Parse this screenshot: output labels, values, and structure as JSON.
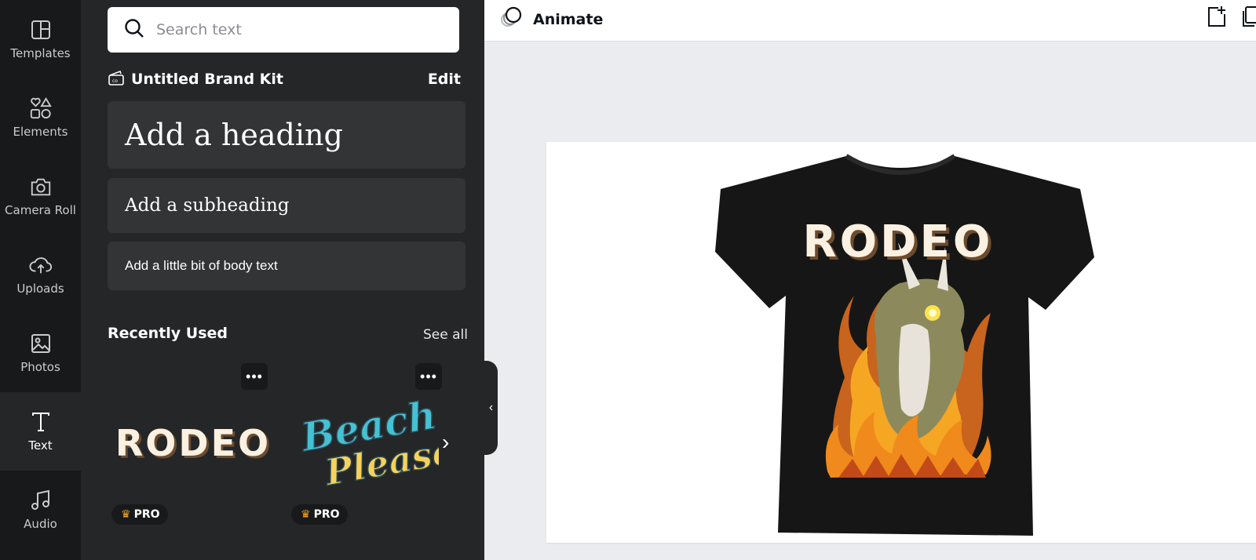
{
  "rail": {
    "items": [
      {
        "label": "Templates",
        "icon": "templates-icon"
      },
      {
        "label": "Elements",
        "icon": "elements-icon"
      },
      {
        "label": "Camera Roll",
        "icon": "camera-icon"
      },
      {
        "label": "Uploads",
        "icon": "upload-cloud-icon"
      },
      {
        "label": "Photos",
        "icon": "image-icon"
      },
      {
        "label": "Text",
        "icon": "text-icon"
      },
      {
        "label": "Audio",
        "icon": "music-note-icon"
      }
    ],
    "active": "Text"
  },
  "panel": {
    "search_placeholder": "Search text",
    "brand_kit": {
      "name": "Untitled Brand Kit",
      "edit_label": "Edit"
    },
    "text_presets": {
      "heading": "Add a heading",
      "subheading": "Add a subheading",
      "body": "Add a little bit of body text"
    },
    "recently_used": {
      "title": "Recently Used",
      "see_all": "See all",
      "items": [
        {
          "text": "RODEO",
          "badge": "PRO"
        },
        {
          "text": "Beach Please",
          "badge": "PRO"
        }
      ]
    }
  },
  "topbar": {
    "animate_label": "Animate"
  },
  "canvas": {
    "shirt_text": "RODEO"
  },
  "colors": {
    "rail_bg": "#18191b",
    "panel_bg": "#252627",
    "card_bg": "#333435",
    "canvas_bg": "#ebecf0",
    "crown": "#f5a623"
  }
}
